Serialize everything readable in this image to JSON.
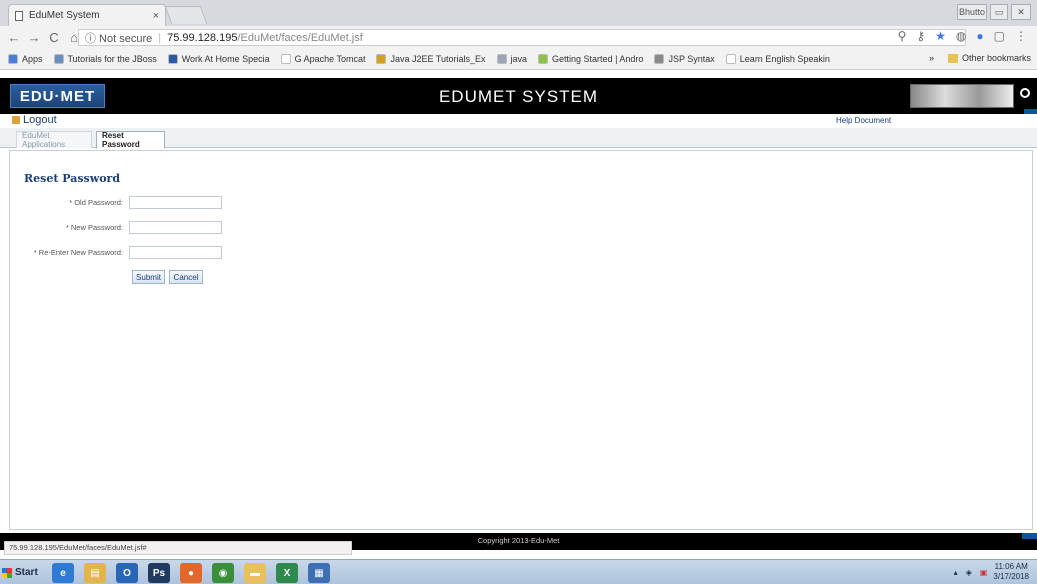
{
  "browser": {
    "tab_title": "EduMet System",
    "tab_close": "×",
    "window_controls": [
      "Bhutto",
      "▭",
      "✕"
    ],
    "nav": {
      "back": "←",
      "forward": "→",
      "reload": "C",
      "home": "⌂"
    },
    "address": {
      "security": "ⓘ Not secure",
      "host": "75.99.128.195",
      "path": "/EduMet/faces/EduMet.jsf"
    },
    "bookmarks": [
      {
        "label": "Apps",
        "color": "#4a7ed8"
      },
      {
        "label": "Tutorials for the JBoss",
        "color": "#6a8fbf"
      },
      {
        "label": "Work At Home Specia",
        "color": "#2b59a8"
      },
      {
        "label": "G  Apache Tomcat",
        "color": "#ffffff"
      },
      {
        "label": "Java J2EE Tutorials_Ex",
        "color": "#d4a019"
      },
      {
        "label": "java",
        "color": "#9aa6b5"
      },
      {
        "label": "Getting Started | Andro",
        "color": "#8bc34a"
      },
      {
        "label": "JSP Syntax",
        "color": "#888888"
      },
      {
        "label": "Learn English Speakin",
        "color": "#ffffff"
      }
    ],
    "bookmarks_more": "»",
    "other_bookmarks": "Other bookmarks"
  },
  "app": {
    "logo": "EDU·MET",
    "title": "EDUMET SYSTEM",
    "logout": "Logout",
    "help_document": "Help Document",
    "tabs": [
      {
        "label": "EduMet Applications",
        "active": false
      },
      {
        "label": "Reset Password",
        "active": true
      }
    ],
    "form": {
      "heading": "Reset Password",
      "fields": [
        {
          "label": "* Old Password:",
          "value": ""
        },
        {
          "label": "* New Password:",
          "value": ""
        },
        {
          "label": "* Re-Enter New Password:",
          "value": ""
        }
      ],
      "submit": "Submit",
      "cancel": "Cancel"
    },
    "copyright": "Copyright 2013-Edu-Met"
  },
  "status_url": "75.99.128.195/EduMet/faces/EduMet.jsf#",
  "taskbar": {
    "start": "Start",
    "icons": [
      {
        "name": "ie-icon",
        "glyph": "e",
        "color": "#2f7bd3"
      },
      {
        "name": "explorer-icon",
        "glyph": "▤",
        "color": "#e3b44a"
      },
      {
        "name": "outlook-icon",
        "glyph": "O",
        "color": "#2a66b8"
      },
      {
        "name": "photoshop-icon",
        "glyph": "Ps",
        "color": "#1e3a5f"
      },
      {
        "name": "firefox-icon",
        "glyph": "●",
        "color": "#e4672a"
      },
      {
        "name": "chrome-icon",
        "glyph": "◉",
        "color": "#3b8f3b"
      },
      {
        "name": "folder-icon",
        "glyph": "▬",
        "color": "#e8c15a"
      },
      {
        "name": "excel-icon",
        "glyph": "X",
        "color": "#2d8a4a"
      },
      {
        "name": "editor-icon",
        "glyph": "▦",
        "color": "#3d6fb3"
      }
    ],
    "time": "11:06 AM",
    "date": "3/17/2018"
  }
}
